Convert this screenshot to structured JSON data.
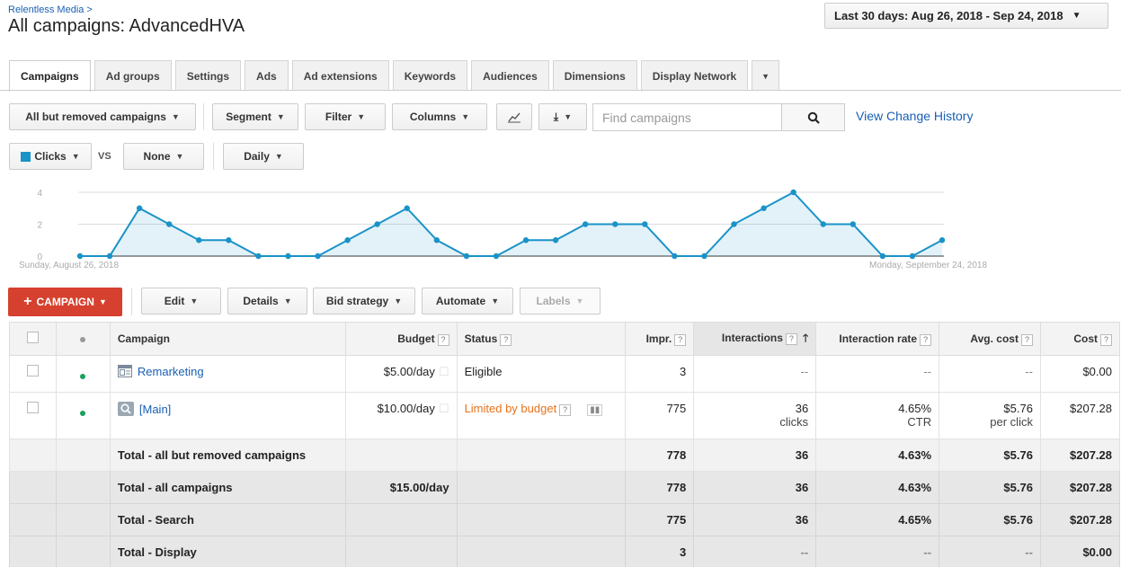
{
  "header": {
    "breadcrumb": "Relentless Media >",
    "title": "All campaigns: AdvancedHVA",
    "date_range": "Last 30 days: Aug 26, 2018 - Sep 24, 2018"
  },
  "tabs": [
    "Campaigns",
    "Ad groups",
    "Settings",
    "Ads",
    "Ad extensions",
    "Keywords",
    "Audiences",
    "Dimensions",
    "Display Network"
  ],
  "toolbar": {
    "filter_campaigns": "All but removed campaigns",
    "segment": "Segment",
    "filter": "Filter",
    "columns": "Columns",
    "search_placeholder": "Find campaigns",
    "view_change_history": "View Change History"
  },
  "chart_controls": {
    "metric1": "Clicks",
    "vs": "VS",
    "metric2": "None",
    "granularity": "Daily"
  },
  "chart_data": {
    "type": "area",
    "y_ticks": [
      "0",
      "2",
      "4"
    ],
    "ylim": [
      0,
      4
    ],
    "x_start_label": "Sunday, August 26, 2018",
    "x_end_label": "Monday, September 24, 2018",
    "series": [
      {
        "values": [
          0,
          0,
          3,
          2,
          1,
          1,
          0,
          0,
          0,
          1,
          2,
          3,
          1,
          0,
          0,
          1,
          1,
          2,
          2,
          2,
          0,
          0,
          2,
          3,
          4,
          2,
          2,
          0,
          0,
          1
        ]
      }
    ],
    "color": "#1a93c8"
  },
  "actions": {
    "new_campaign": "CAMPAIGN",
    "edit": "Edit",
    "details": "Details",
    "bid_strategy": "Bid strategy",
    "automate": "Automate",
    "labels": "Labels"
  },
  "table": {
    "headers": {
      "campaign": "Campaign",
      "budget": "Budget",
      "status": "Status",
      "impr": "Impr.",
      "interactions": "Interactions",
      "interaction_rate": "Interaction rate",
      "avg_cost": "Avg. cost",
      "cost": "Cost"
    },
    "rows": [
      {
        "name": "Remarketing",
        "budget": "$5.00/day",
        "status": "Eligible",
        "impr": "3",
        "interactions": "--",
        "interactions_sub": "",
        "rate": "--",
        "rate_sub": "",
        "avg_cost": "--",
        "avg_cost_sub": "",
        "cost": "$0.00"
      },
      {
        "name": "[Main]",
        "budget": "$10.00/day",
        "status": "Limited by budget",
        "impr": "775",
        "interactions": "36",
        "interactions_sub": "clicks",
        "rate": "4.65%",
        "rate_sub": "CTR",
        "avg_cost": "$5.76",
        "avg_cost_sub": "per click",
        "cost": "$207.28"
      }
    ],
    "totals": [
      {
        "label": "Total - all but removed campaigns",
        "budget": "",
        "impr": "778",
        "interactions": "36",
        "rate": "4.63%",
        "avg_cost": "$5.76",
        "cost": "$207.28"
      },
      {
        "label": "Total - all campaigns",
        "budget": "$15.00/day",
        "impr": "778",
        "interactions": "36",
        "rate": "4.63%",
        "avg_cost": "$5.76",
        "cost": "$207.28"
      },
      {
        "label": "Total - Search",
        "budget": "",
        "impr": "775",
        "interactions": "36",
        "rate": "4.65%",
        "avg_cost": "$5.76",
        "cost": "$207.28"
      },
      {
        "label": "Total - Display",
        "budget": "",
        "impr": "3",
        "interactions": "--",
        "rate": "--",
        "avg_cost": "--",
        "cost": "$0.00"
      }
    ]
  }
}
